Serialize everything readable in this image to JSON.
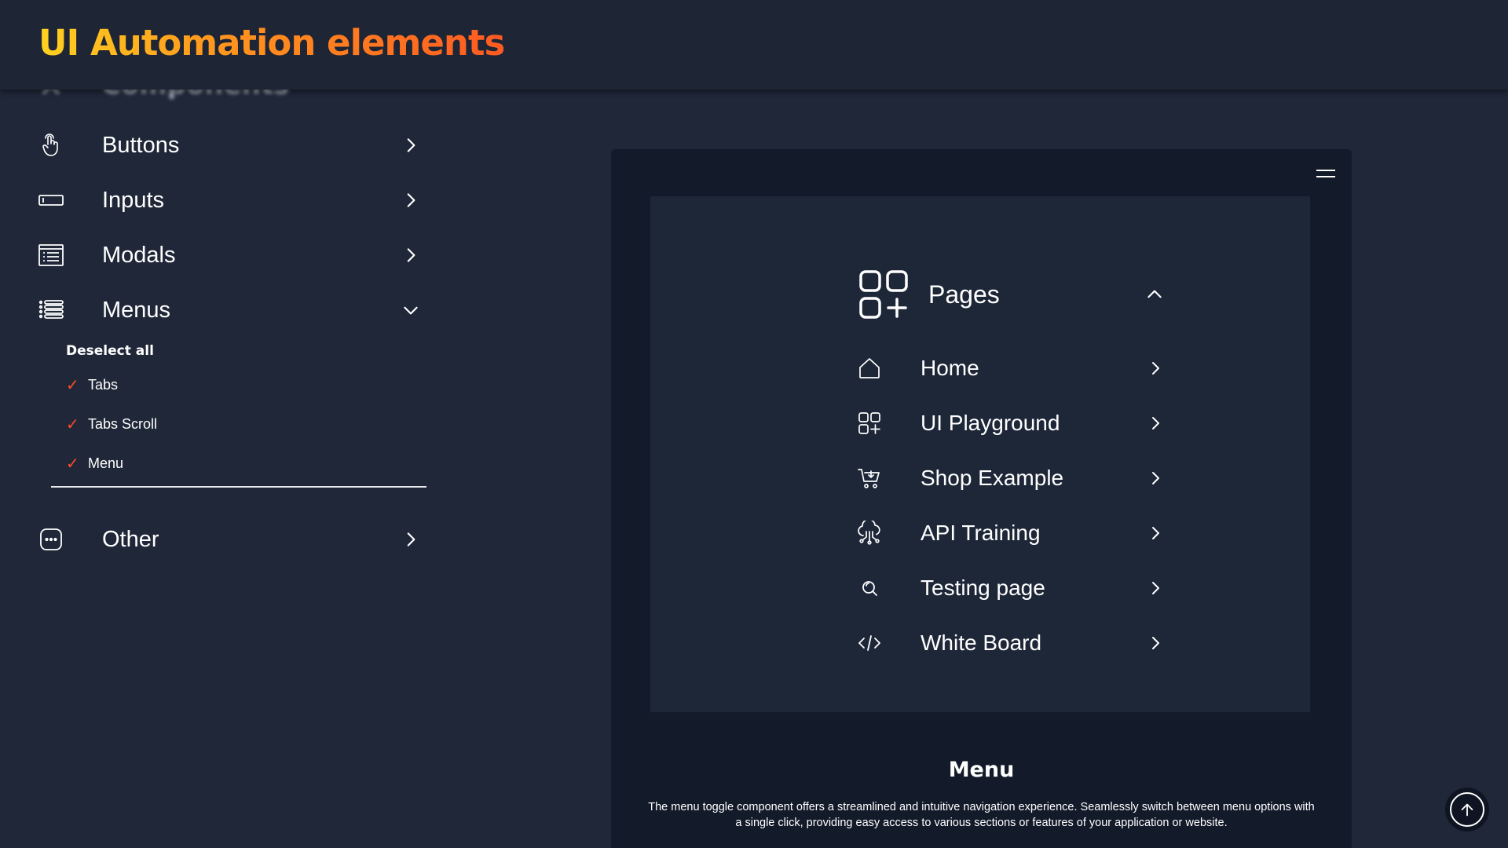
{
  "header": {
    "title": "UI Automation elements"
  },
  "sidebar": {
    "section_label": "Components",
    "items": [
      {
        "label": "Buttons",
        "icon": "hand-pointer-icon"
      },
      {
        "label": "Inputs",
        "icon": "input-field-icon"
      },
      {
        "label": "Modals",
        "icon": "modal-window-icon"
      },
      {
        "label": "Menus",
        "icon": "list-icon"
      },
      {
        "label": "Other",
        "icon": "more-dots-icon"
      }
    ],
    "submenu": {
      "deselect_label": "Deselect all",
      "items": [
        {
          "label": "Tabs",
          "checked": true
        },
        {
          "label": "Tabs Scroll",
          "checked": true
        },
        {
          "label": "Menu",
          "checked": true
        }
      ]
    }
  },
  "main": {
    "menu": {
      "header_label": "Pages",
      "items": [
        {
          "label": "Home",
          "icon": "home-icon"
        },
        {
          "label": "UI Playground",
          "icon": "apps-grid-icon"
        },
        {
          "label": "Shop Example",
          "icon": "cart-icon"
        },
        {
          "label": "API Training",
          "icon": "cloud-network-icon"
        },
        {
          "label": "Testing page",
          "icon": "search-icon"
        },
        {
          "label": "White Board",
          "icon": "code-icon"
        }
      ]
    },
    "title": "Menu",
    "description": "The menu toggle component offers a streamlined and intuitive navigation experience. Seamlessly switch between menu options with a single click, providing easy access to various sections or features of your application or website."
  },
  "colors": {
    "background": "#1f2738",
    "card": "#131a29",
    "panel": "#1e2738",
    "accent_check": "#ff4a2a",
    "title_gradient_start": "#ffd21f",
    "title_gradient_end": "#ff5a22"
  }
}
